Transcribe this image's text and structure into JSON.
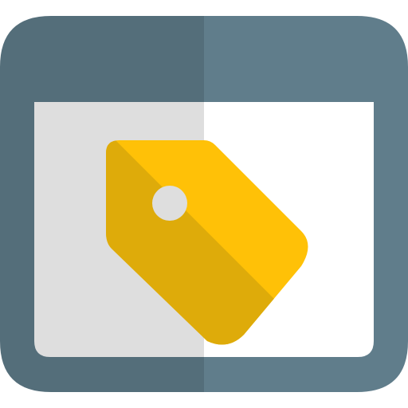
{
  "icon": {
    "name": "browser-window-price-tag-icon",
    "colors": {
      "frame_light": "#607D8B",
      "frame_dark": "#546E7A",
      "content_light": "#FFFFFF",
      "content_dark": "#DEDEDE",
      "tag_light": "#FFC107",
      "tag_dark": "#DEAB0A",
      "tag_hole": "#DEDEDE"
    }
  }
}
